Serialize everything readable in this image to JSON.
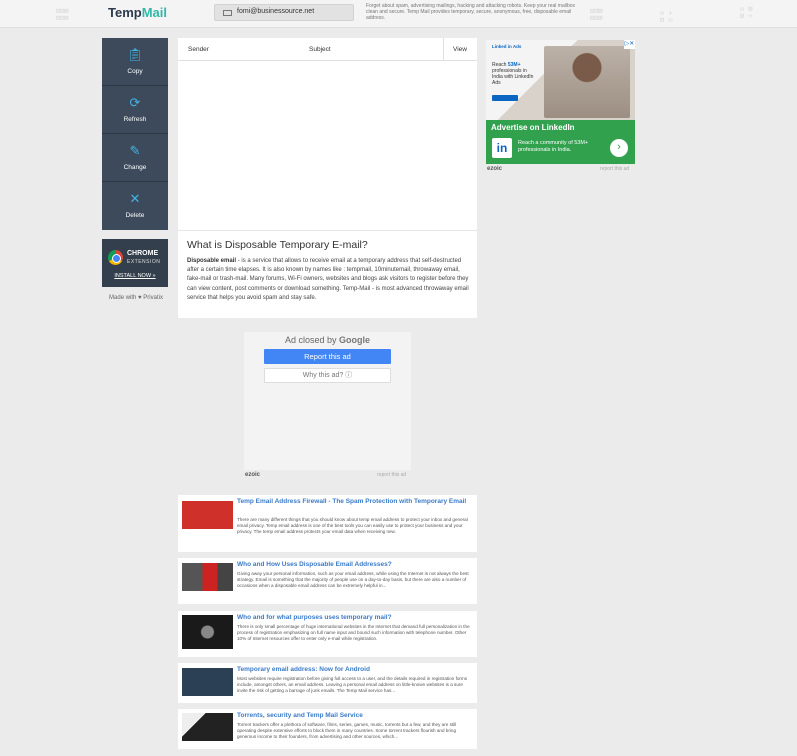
{
  "header": {
    "logo_main": "Temp",
    "logo_accent": "Mail",
    "email_value": "fomi@businessource.net",
    "tagline": "Forget about spam, advertising mailings, hacking and attacking robots. Keep your real mailbox clean and secure. Temp Mail provides temporary, secure, anonymous, free, disposable email address."
  },
  "sidebar": {
    "items": [
      {
        "label": "Copy",
        "icon": "clipboard-icon"
      },
      {
        "label": "Refresh",
        "icon": "refresh-icon"
      },
      {
        "label": "Change",
        "icon": "edit-icon"
      },
      {
        "label": "Delete",
        "icon": "close-icon"
      }
    ],
    "chrome": {
      "title": "CHROME",
      "sub": "EXTENSION",
      "install": "INSTALL NOW »"
    },
    "made_with": "Made with ♥ Privatix"
  },
  "inbox": {
    "columns": [
      "Sender",
      "Subject",
      "View"
    ]
  },
  "info": {
    "title": "What is Disposable Temporary E-mail?",
    "lead": "Disposable email",
    "body": " - is a service that allows to receive email at a temporary address that self-destructed after a certain time elapses. It is also known by names like : tempmail, 10minutemail, throwaway email, fake-mail or trash-mail. Many forums, Wi-Fi owners, websites and blogs ask visitors to register before they can view content, post comments or download something. Temp-Mail - is most advanced throwaway email service that helps you avoid spam and stay safe."
  },
  "ad_right": {
    "brand": "Linked in Ads",
    "reach_prefix": "Reach ",
    "reach_bold": "53M+",
    "reach_suffix": " professionals in India with LinkedIn Ads",
    "headline": "Advertise on LinkedIn",
    "logo": "in",
    "text": "Reach a community of 53M+ professionals in India.",
    "arrow": "›",
    "close": "▷✕",
    "ezoic": "ezoic",
    "report": "report this ad"
  },
  "ad_mid": {
    "closed_prefix": "Ad closed by ",
    "closed_brand": "Google",
    "report_btn": "Report this ad",
    "why_btn": "Why this ad? ⓘ",
    "ezoic": "ezoic",
    "report": "report this ad"
  },
  "articles": [
    {
      "title": "Temp Email Address Firewall - The Spam Protection with Temporary Email",
      "desc": "There are many different things that you should know about temp email address to protect your inbox and general email privacy. Temp email address is one of the best tools you can easily use to protect your business and your privacy. The temp email address protects your email data when receiving new.",
      "thumb": "#d0302a"
    },
    {
      "title": "Who and How Uses Disposable Email Addresses?",
      "desc": "Giving away your personal information, such as your email address, while using the Internet is not always the best strategy. Email is something that the majority of people use on a day-to-day basis, but there are also a number of occasions when a disposable email address can be extremely helpful in...",
      "thumb": "#3a3a3a"
    },
    {
      "title": "Who and for what purposes uses temporary mail?",
      "desc": "There is only small percentage of huge international websites in the Internet that demand full personalization in the process of registration emphasizing on full name input and bound such information with telephone number. Other 10% of Internet resources offer to enter only e-mail while registration.",
      "thumb": "#222222"
    },
    {
      "title": "Temporary email address: Now for Android",
      "desc": "Most websites require registration before giving full access to a user, and the details required in registration forms include, amongst others, an email address. Leaving a personal email address on little-known websites is a sure invite the risk of getting a barrage of junk emails. The Temp Mail service has...",
      "thumb": "#2b3f55"
    },
    {
      "title": "Torrents, security and Temp Mail Service",
      "desc": "Torrent trackers offer a plethora of software, films, series, games, music, torrents but a few, and they are still operating despite extensive efforts to block them in many countries. Some torrent trackers flourish and bring generous income to their founders, from advertising and other sources, which...",
      "thumb": "#333333"
    }
  ]
}
